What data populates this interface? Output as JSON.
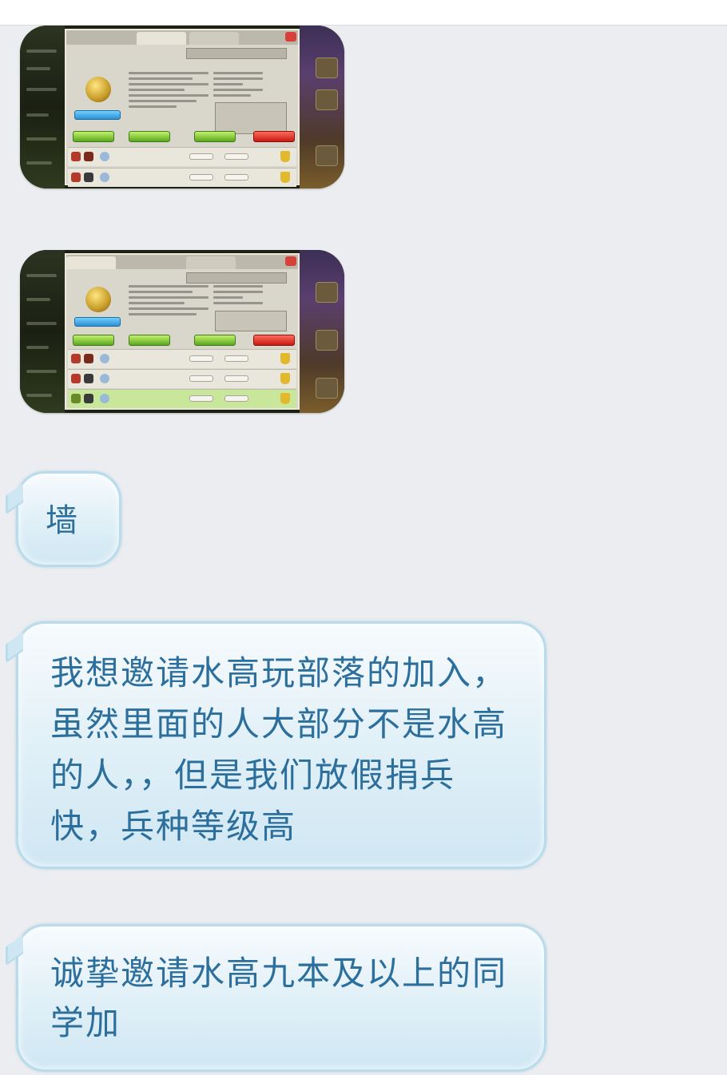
{
  "messages": [
    {
      "type": "image",
      "icon": "game-screenshot"
    },
    {
      "type": "image",
      "icon": "game-screenshot"
    },
    {
      "type": "text",
      "text": "墙"
    },
    {
      "type": "text",
      "text": "我想邀请水高玩部落的加入，虽然里面的人大部分不是水高的人，，但是我们放假捐兵快，兵种等级高"
    },
    {
      "type": "text",
      "text": "诚挚邀请水高九本及以上的同学加"
    }
  ],
  "colors": {
    "background": "#ebedf0",
    "bubble_text": "#2d6f9c",
    "bubble_border": "#b9dcec"
  }
}
